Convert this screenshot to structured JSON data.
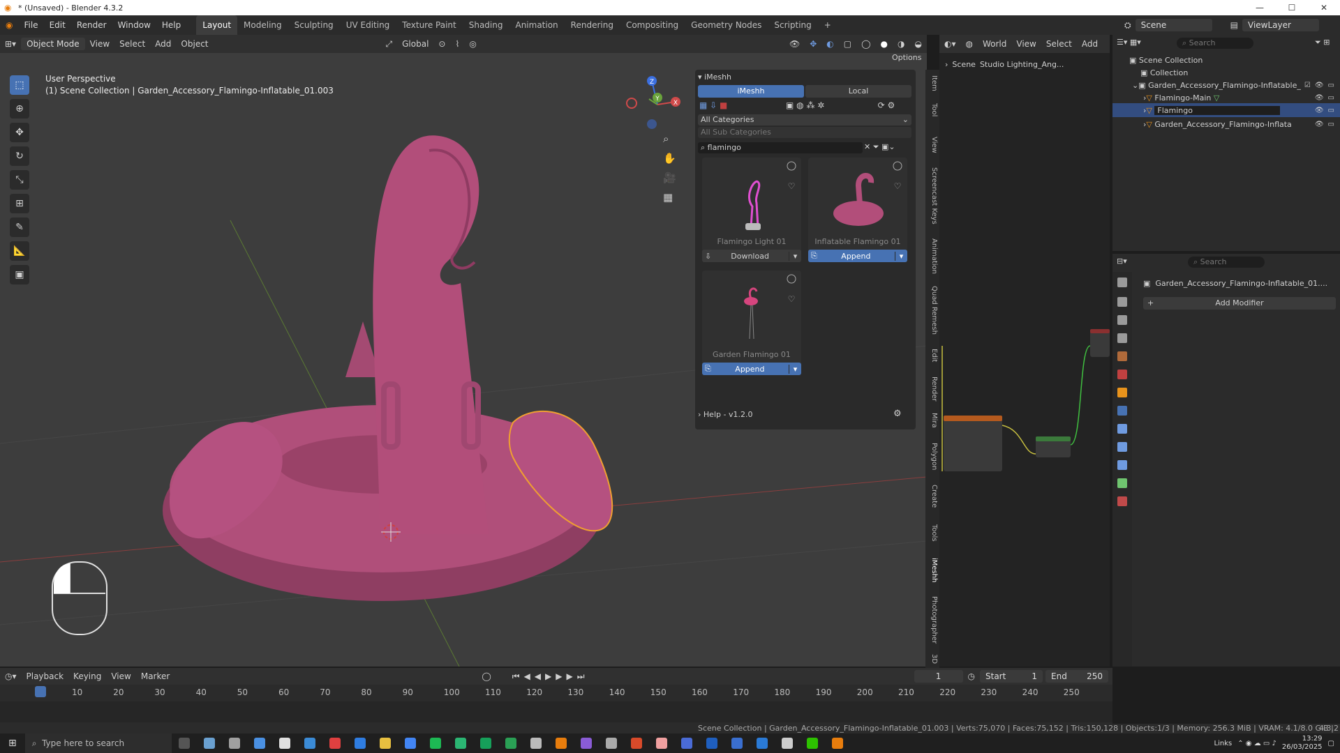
{
  "title": "* (Unsaved) - Blender 4.3.2",
  "window_buttons": [
    "—",
    "☐",
    "✕"
  ],
  "menu": [
    "File",
    "Edit",
    "Render",
    "Window",
    "Help"
  ],
  "workspaces": [
    "Layout",
    "Modeling",
    "Sculpting",
    "UV Editing",
    "Texture Paint",
    "Shading",
    "Animation",
    "Rendering",
    "Compositing",
    "Geometry Nodes",
    "Scripting"
  ],
  "scene_label": "Scene",
  "viewlayer_label": "ViewLayer",
  "viewport": {
    "mode": "Object Mode",
    "menu": [
      "View",
      "Select",
      "Add",
      "Object"
    ],
    "transform": "Global",
    "options": "Options",
    "perspective": "User Perspective",
    "collection_line": "(1) Scene Collection | Garden_Accessory_Flamingo-Inflatable_01.003"
  },
  "imeshh": {
    "header": "iMeshh",
    "tab_active": "iMeshh",
    "tab_other": "Local",
    "category": "All Categories",
    "subcategory": "All Sub Categories",
    "search": "flamingo",
    "cards": [
      {
        "name": "Flamingo Light 01",
        "button": "Download"
      },
      {
        "name": "Inflatable Flamingo 01",
        "button": "Append"
      },
      {
        "name": "Garden Flamingo 01",
        "button": "Append"
      }
    ],
    "help": "Help - v1.2.0"
  },
  "side_tabs": [
    "Item",
    "Tool",
    "View",
    "Screencast Keys",
    "Animation",
    "Quad Remesh",
    "Edit",
    "Render",
    "Mira",
    "Polygon",
    "Create",
    "Tools",
    "iMeshh",
    "Photographer",
    "3D"
  ],
  "node_header": {
    "world": "World",
    "menu": [
      "View",
      "Select",
      "Add"
    ],
    "breadcrumb_scene": "Scene",
    "breadcrumb_world": "Studio Lighting_Ang..."
  },
  "outliner": {
    "search_placeholder": "Search",
    "rows": [
      {
        "label": "Scene Collection"
      },
      {
        "label": "Collection"
      },
      {
        "label": "Garden_Accessory_Flamingo-Inflatable_"
      },
      {
        "label": "Flamingo-Main"
      },
      {
        "label": "Flamingo"
      },
      {
        "label": "Garden_Accessory_Flamingo-Inflata"
      }
    ]
  },
  "properties": {
    "search_placeholder": "Search",
    "object_name": "Garden_Accessory_Flamingo-Inflatable_01....",
    "add_modifier": "Add Modifier"
  },
  "timeline": {
    "menu": [
      "Playback",
      "Keying",
      "View",
      "Marker"
    ],
    "current": "1",
    "start_label": "Start",
    "start": "1",
    "end_label": "End",
    "end": "250",
    "ticks": [
      "1",
      "10",
      "20",
      "30",
      "40",
      "50",
      "60",
      "70",
      "80",
      "90",
      "100",
      "110",
      "120",
      "130",
      "140",
      "150",
      "160",
      "170",
      "180",
      "190",
      "200",
      "210",
      "220",
      "230",
      "240",
      "250"
    ]
  },
  "status": {
    "text": "Scene Collection | Garden_Accessory_Flamingo-Inflatable_01.003 | Verts:75,070 | Faces:75,152 | Tris:150,128 | Objects:1/3 | Memory: 256.3 MiB | VRAM: 4.1/8.0 GiB |",
    "version": "4.3.2"
  },
  "taskbar": {
    "search_placeholder": "Type here to search",
    "links": "Links",
    "time": "13:29",
    "date": "26/03/2025"
  },
  "colors": {
    "accent": "#4772b3",
    "flamingo": "#b4527a",
    "selection": "#e8931c"
  }
}
